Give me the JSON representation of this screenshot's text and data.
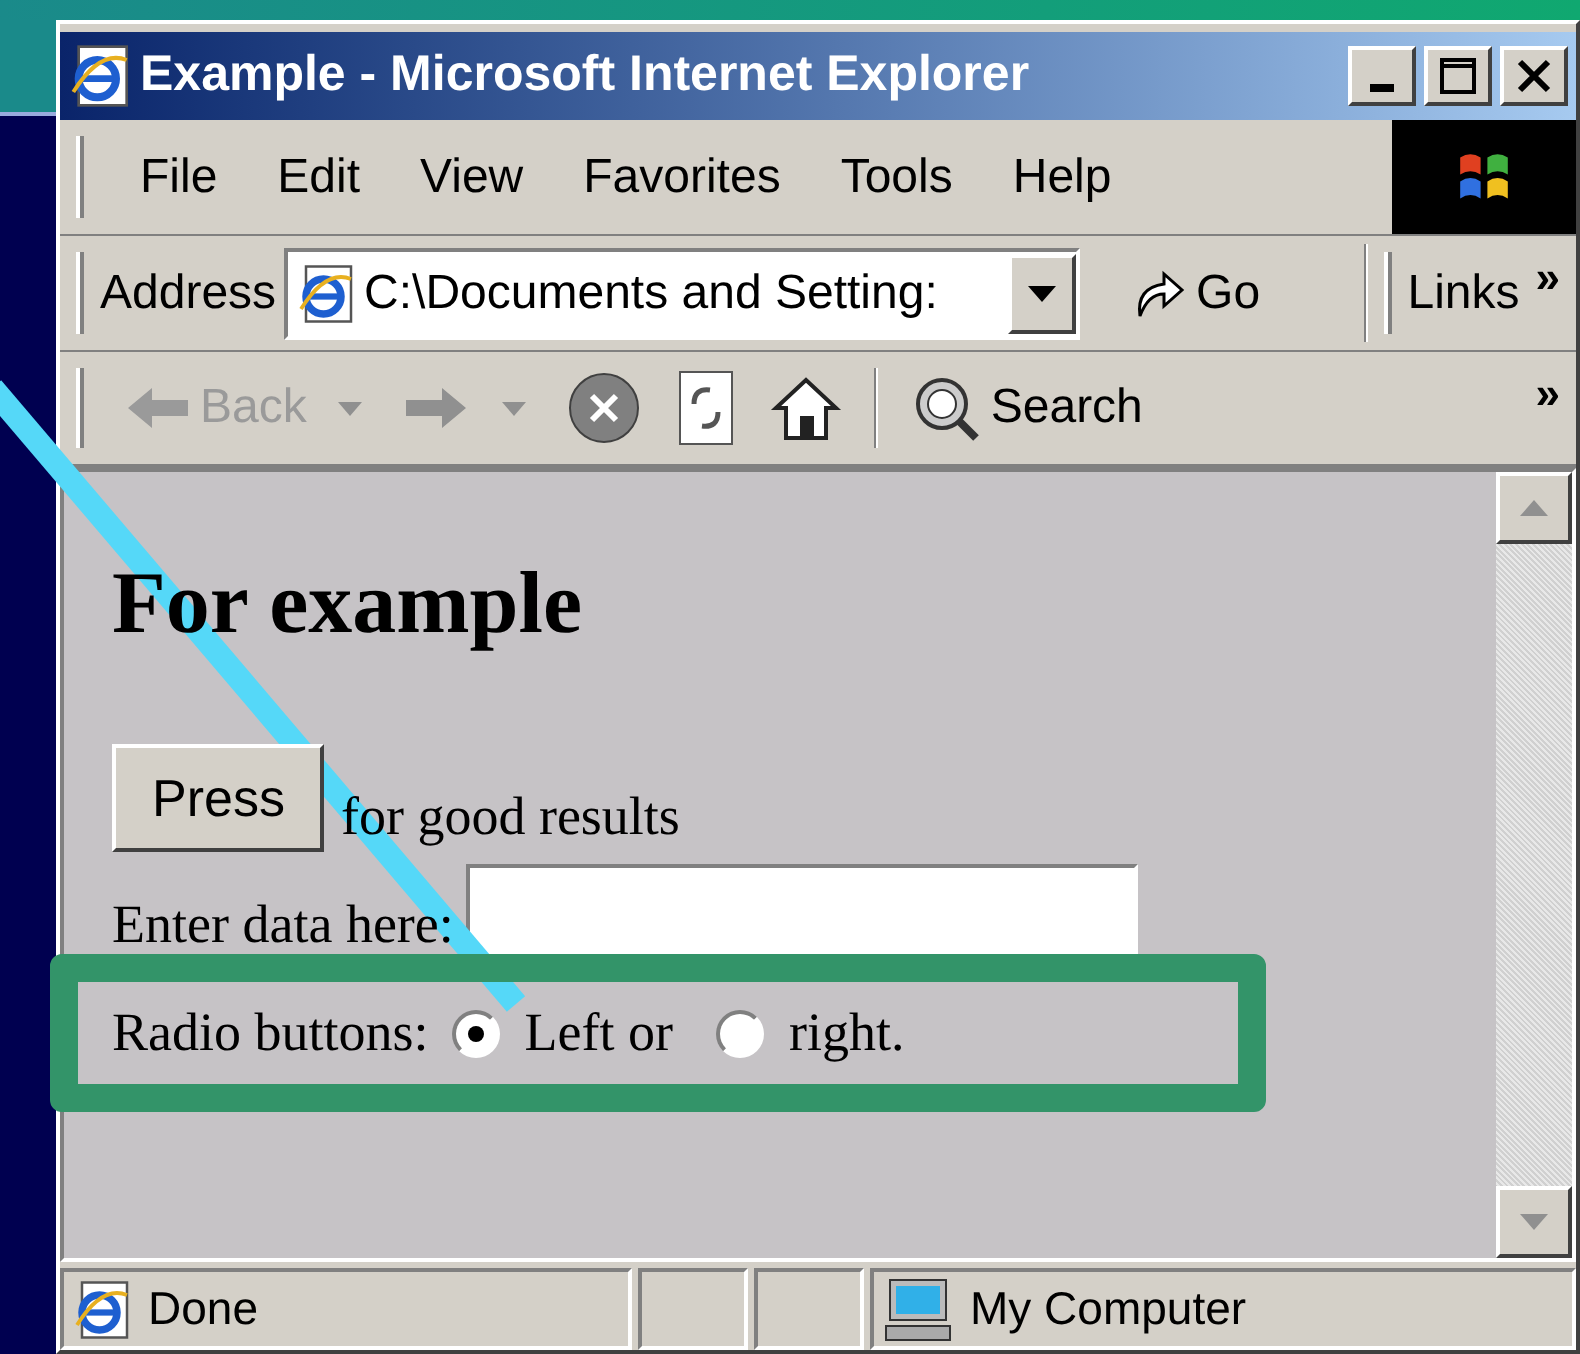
{
  "window": {
    "title": "Example - Microsoft Internet Explorer"
  },
  "menu": [
    "File",
    "Edit",
    "View",
    "Favorites",
    "Tools",
    "Help"
  ],
  "address_bar": {
    "label": "Address",
    "value": "C:\\Documents and Setting:",
    "go": "Go",
    "links": "Links",
    "more": "»"
  },
  "toolbar": {
    "back": {
      "label": "Back",
      "disabled": true
    },
    "search": "Search",
    "more": "»"
  },
  "page": {
    "heading": "For example",
    "button": "Press",
    "button_caption": "for good results",
    "field_label": "Enter data here:",
    "radio_label": "Radio buttons:",
    "radios": [
      {
        "label": "Left or",
        "selected": true
      },
      {
        "label": "right.",
        "selected": false
      }
    ]
  },
  "status_bar": {
    "status": "Done",
    "zone": "My Computer"
  }
}
